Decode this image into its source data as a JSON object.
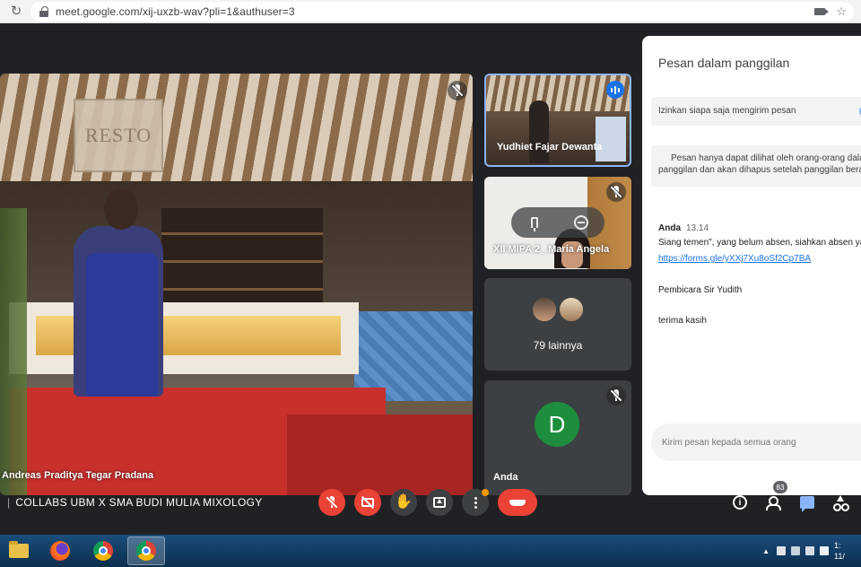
{
  "browser": {
    "url": "meet.google.com/xij-uxzb-wav?pli=1&authuser=3",
    "icons": [
      "reload-icon",
      "lock-icon",
      "camera-blocked-icon",
      "star-icon"
    ]
  },
  "meeting": {
    "title": "COLLABS UBM X SMA BUDI MULIA MIXOLOGY",
    "separator": "|"
  },
  "main_video": {
    "participant": "Andreas Praditya Tegar Pradana",
    "muted": true,
    "sign_text": "RESTO"
  },
  "tiles": [
    {
      "name": "Yudhiet Fajar Dewanta",
      "speaking": true
    },
    {
      "name": "XII MIPA 2_ Maria Angela",
      "muted": true
    },
    {
      "label": "79 lainnya"
    },
    {
      "name": "Anda",
      "avatar_letter": "D",
      "avatar_color": "#1e8e3e",
      "muted": true
    }
  ],
  "chat": {
    "title": "Pesan dalam panggilan",
    "toggle_label": "Izinkan siapa saja mengirim pesan",
    "toggle_on": true,
    "note_line1": "Pesan hanya dapat dilihat oleh orang-orang dalam",
    "note_line2": "panggilan dan akan dihapus setelah panggilan berak",
    "message": {
      "sender": "Anda",
      "time": "13.14",
      "line1": "Siang temen\", yang belum absen, siahkan absen ya",
      "link": "https://forms.gle/yXXj7Xu8oSf2Cp7BA",
      "line2": "Pembicara Sir Yudith",
      "line3": "terima kasih"
    },
    "input_placeholder": "Kirim pesan kepada semua orang"
  },
  "controls": {
    "mic": "mic-off",
    "camera": "camera-off",
    "hand": "✋",
    "people_count": "83",
    "info": "i"
  },
  "taskbar": {
    "clock_time": "1:",
    "clock_date": "11/"
  },
  "colors": {
    "meet_dark": "#202124",
    "tile_grey": "#3c4043",
    "danger_red": "#ea4335",
    "accent_blue": "#1a73e8",
    "speaking_border": "#8ab4f8"
  }
}
